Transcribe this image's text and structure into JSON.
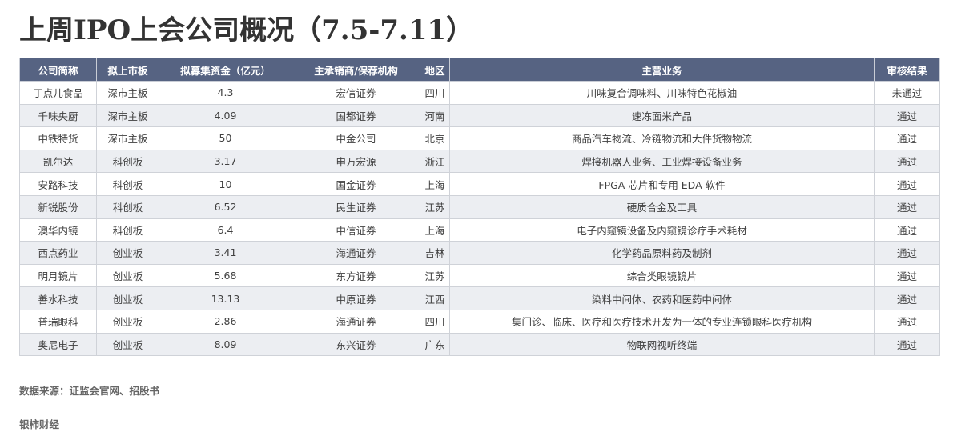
{
  "title": "上周IPO上会公司概况（7.5-7.11）",
  "table": {
    "headers": [
      "公司简称",
      "拟上市板",
      "拟募集资金（亿元）",
      "主承销商/保荐机构",
      "地区",
      "主营业务",
      "审核结果"
    ],
    "rows": [
      [
        "丁点儿食品",
        "深市主板",
        "4.3",
        "宏信证券",
        "四川",
        "川味复合调味料、川味特色花椒油",
        "未通过"
      ],
      [
        "千味央厨",
        "深市主板",
        "4.09",
        "国都证券",
        "河南",
        "速冻面米产品",
        "通过"
      ],
      [
        "中铁特货",
        "深市主板",
        "50",
        "中金公司",
        "北京",
        "商品汽车物流、冷链物流和大件货物物流",
        "通过"
      ],
      [
        "凯尔达",
        "科创板",
        "3.17",
        "申万宏源",
        "浙江",
        "焊接机器人业务、工业焊接设备业务",
        "通过"
      ],
      [
        "安路科技",
        "科创板",
        "10",
        "国金证券",
        "上海",
        "FPGA 芯片和专用 EDA 软件",
        "通过"
      ],
      [
        "新锐股份",
        "科创板",
        "6.52",
        "民生证券",
        "江苏",
        "硬质合金及工具",
        "通过"
      ],
      [
        "澳华内镜",
        "科创板",
        "6.4",
        "中信证券",
        "上海",
        "电子内窥镜设备及内窥镜诊疗手术耗材",
        "通过"
      ],
      [
        "西点药业",
        "创业板",
        "3.41",
        "海通证券",
        "吉林",
        "化学药品原料药及制剂",
        "通过"
      ],
      [
        "明月镜片",
        "创业板",
        "5.68",
        "东方证券",
        "江苏",
        "综合类眼镜镜片",
        "通过"
      ],
      [
        "善水科技",
        "创业板",
        "13.13",
        "中原证券",
        "江西",
        "染料中间体、农药和医药中间体",
        "通过"
      ],
      [
        "普瑞眼科",
        "创业板",
        "2.86",
        "海通证券",
        "四川",
        "集门诊、临床、医疗和医疗技术开发为一体的专业连锁眼科医疗机构",
        "通过"
      ],
      [
        "奥尼电子",
        "创业板",
        "8.09",
        "东兴证券",
        "广东",
        "物联网视听终端",
        "通过"
      ]
    ]
  },
  "footer": {
    "source": "数据来源：证监会官网、招股书",
    "brand": "银柿财经"
  },
  "colors": {
    "header_bg": "#566382",
    "header_text": "#ffffff",
    "row_alt_bg": "#eceef2",
    "border": "#cfd2d8"
  }
}
